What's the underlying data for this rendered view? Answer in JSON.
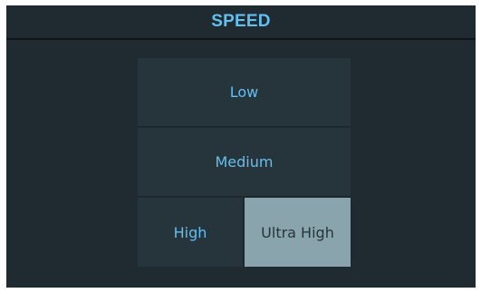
{
  "header": {
    "title": "SPEED"
  },
  "speed_options": [
    {
      "label": "Low",
      "selected": false
    },
    {
      "label": "Medium",
      "selected": false
    },
    {
      "label": "High",
      "selected": false
    },
    {
      "label": "Ultra High",
      "selected": true
    }
  ],
  "colors": {
    "background": "#1f2a31",
    "button": "#26343b",
    "selected_button": "#8aa4ae",
    "accent_text": "#63bff0",
    "selected_text": "#26343b"
  }
}
